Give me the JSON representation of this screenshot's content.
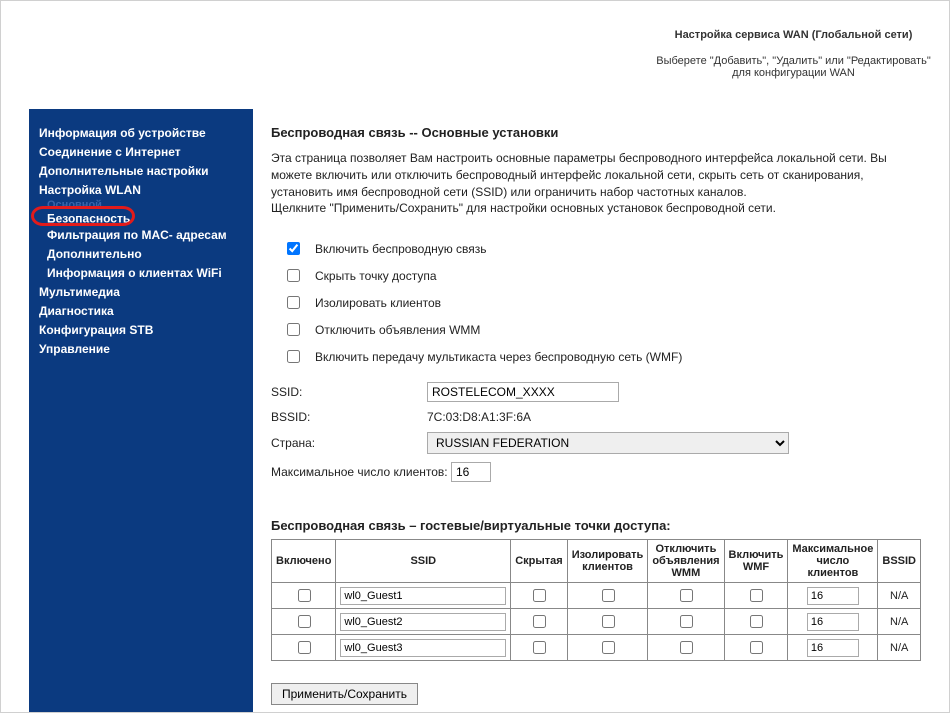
{
  "topbar": {
    "title": "Настройка сервиса WAN (Глобальной сети)",
    "desc": "Выберете \"Добавить\", \"Удалить\" или \"Редактировать\" для конфигурации WAN"
  },
  "sidebar": {
    "ghost_text": "Основной",
    "items": [
      "Информация об устройстве",
      "Соединение с Интернет",
      "Дополнительные настройки",
      "Настройка WLAN"
    ],
    "wlan_sub": [
      "Безопасность",
      "Фильтрация по MAC- адресам",
      "Дополнительно",
      "Информация о клиентах WiFi"
    ],
    "items2": [
      "Мультимедиа",
      "Диагностика",
      "Конфигурация STB",
      "Управление"
    ]
  },
  "main": {
    "heading": "Беспроводная связь -- Основные установки",
    "intro1": "Эта страница позволяет Вам настроить основные параметры беспроводного интерфейса локальной сети. Вы можете включить или отключить беспроводный интерфейс локальной сети, скрыть сеть от сканирования, установить имя беспроводной сети (SSID) или ограничить набор частотных каналов.",
    "intro2": "Щелкните \"Применить/Сохранить\" для настройки основных установок беспроводной сети.",
    "checkboxes": {
      "enable": "Включить беспроводную связь",
      "hide": "Скрыть точку доступа",
      "isolate": "Изолировать клиентов",
      "wmm": "Отключить объявления WMM",
      "wmf": "Включить передачу мультикаста через беспроводную сеть (WMF)"
    },
    "form": {
      "ssid_label": "SSID:",
      "ssid_value": "ROSTELECOM_XXXX",
      "bssid_label": "BSSID:",
      "bssid_value": "7C:03:D8:A1:3F:6A",
      "country_label": "Страна:",
      "country_value": "RUSSIAN FEDERATION",
      "max_label": "Максимальное число клиентов:",
      "max_value": "16"
    },
    "guest": {
      "heading": "Беспроводная связь – гостевые/виртуальные точки доступа:",
      "headers": {
        "enabled": "Включено",
        "ssid": "SSID",
        "hidden": "Скрытая",
        "isolate": "Изолировать клиентов",
        "wmm": "Отключить объявления WMM",
        "wmf": "Включить WMF",
        "max": "Максимальное число клиентов",
        "bssid": "BSSID"
      },
      "rows": [
        {
          "ssid": "wl0_Guest1",
          "max": "16",
          "bssid": "N/A"
        },
        {
          "ssid": "wl0_Guest2",
          "max": "16",
          "bssid": "N/A"
        },
        {
          "ssid": "wl0_Guest3",
          "max": "16",
          "bssid": "N/A"
        }
      ]
    },
    "apply_label": "Применить/Сохранить"
  }
}
